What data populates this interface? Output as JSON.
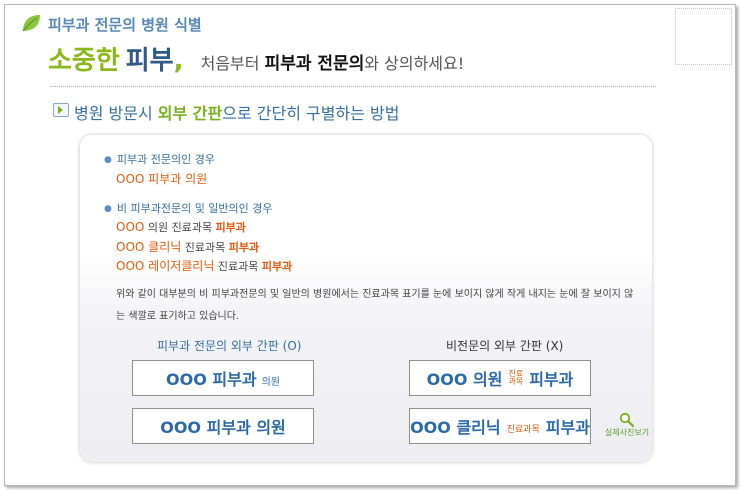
{
  "header": {
    "title": "피부과 전문의 병원 식별",
    "slogan_big_1": "소중한",
    "slogan_big_2": "피부",
    "slogan_comma": ",",
    "slogan_pre": "처음부터",
    "slogan_bold": "피부과 전문의",
    "slogan_post": "와 상의하세요!"
  },
  "section": {
    "title_pre": "병원 방문시",
    "title_hl": "외부 간판",
    "title_post": "으로 간단히 구별하는 방법"
  },
  "card": {
    "case1": {
      "heading": "피부과 전문의인 경우",
      "example": "OOO 피부과 의원"
    },
    "case2": {
      "heading": "비 피부과전문의 및 일반의인 경우",
      "rows": [
        {
          "name": "OOO",
          "mid": "의원 진료과목",
          "dept": "피부과"
        },
        {
          "name": "OOO 클리닉",
          "mid": "진료과목",
          "dept": "피부과"
        },
        {
          "name": "OOO 레이저클리닉",
          "mid": "진료과목",
          "dept": "피부과"
        }
      ]
    },
    "description": "위와 같이 대부분의 비 피부과전문의 및 일반의 병원에서는 진료과목 표기를 눈에 보이지 않게 작게 내지는 눈에 잘 보이지 않는 색깔로 표기하고 있습니다.",
    "left_column": {
      "heading": "피부과 전문의 외부 간판 (O)",
      "sign1_main": "OOO 피부과",
      "sign1_small": "의원",
      "sign2_main": "OOO 피부과 의원"
    },
    "right_column": {
      "heading": "비전문의 외부 간판 (X)",
      "sign1_main": "OOO 의원",
      "sign1_tiny_top": "진료",
      "sign1_tiny_bottom": "과목",
      "sign1_dept": "피부과",
      "sign2_main": "OOO 클리닉",
      "sign2_tiny": "진료과목",
      "sign2_dept": "피부과"
    },
    "photo_link": "실제사진보기"
  },
  "colors": {
    "green": "#8cb81c",
    "blue": "#2d6aa8",
    "orange": "#e05a10"
  },
  "icons": [
    "leaf-icon",
    "play-icon",
    "magnifier-icon"
  ]
}
